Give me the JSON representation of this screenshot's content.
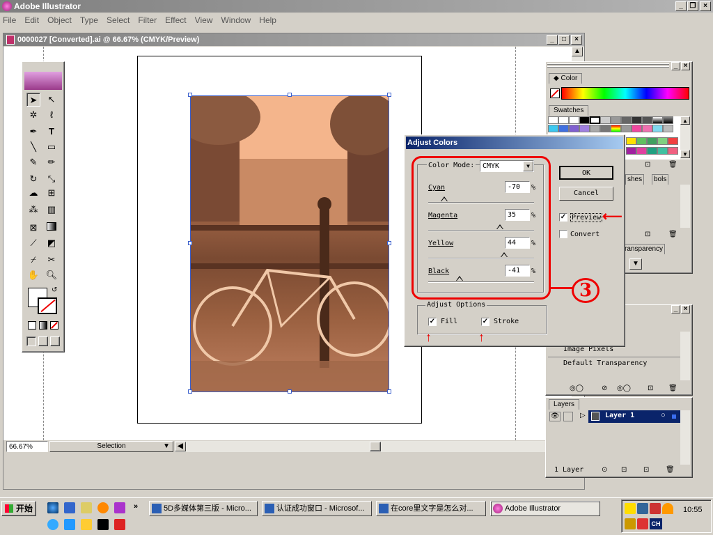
{
  "app": {
    "title": "Adobe Illustrator"
  },
  "menu": [
    "File",
    "Edit",
    "Object",
    "Type",
    "Select",
    "Filter",
    "Effect",
    "View",
    "Window",
    "Help"
  ],
  "document": {
    "title": "0000027 [Converted].ai @ 66.67% (CMYK/Preview)"
  },
  "statusbar": {
    "zoom": "66.67%",
    "tool": "Selection"
  },
  "color_panel": {
    "tab": "Color"
  },
  "swatches_panel": {
    "tab": "Swatches"
  },
  "brushes_panel": {
    "tabs": [
      "shes",
      "bols"
    ]
  },
  "transparency_panel": {
    "tab": "ransparency"
  },
  "links_panel": {
    "items": [
      "Image Pixels",
      "Default Transparency"
    ]
  },
  "layers_panel": {
    "tab": "Layers",
    "layer_name": "Layer 1",
    "footer": "1 Layer"
  },
  "dialog": {
    "title": "Adjust Colors",
    "color_mode_label": "Color Mode:",
    "color_mode_value": "CMYK",
    "sliders": [
      {
        "label": "Cyan",
        "value": "-70",
        "unit": "%",
        "level": -0.7
      },
      {
        "label": "Magenta",
        "value": "35",
        "unit": "%",
        "level": 0.35
      },
      {
        "label": "Yellow",
        "value": "44",
        "unit": "%",
        "level": 0.44
      },
      {
        "label": "Black",
        "value": "-41",
        "unit": "%",
        "level": -0.41
      }
    ],
    "ok": "OK",
    "cancel": "Cancel",
    "preview": "Preview",
    "convert": "Convert",
    "adjust_options": "Adjust Options",
    "fill": "Fill",
    "stroke": "Stroke"
  },
  "annotation": {
    "circled_number": "3"
  },
  "taskbar": {
    "start": "开始",
    "tasks": [
      "5D多媒体第三版 - Micro...",
      "认证成功窗口 - Microsof...",
      "在core里文字是怎么对...",
      "Adobe Illustrator"
    ],
    "quicklaunch_more": "»",
    "tray_ime": "CH",
    "clock": "10:55"
  },
  "colors": {
    "accent": "#e00000",
    "layer_select": "#0a246a",
    "photo_tint": "#e8a07a"
  }
}
